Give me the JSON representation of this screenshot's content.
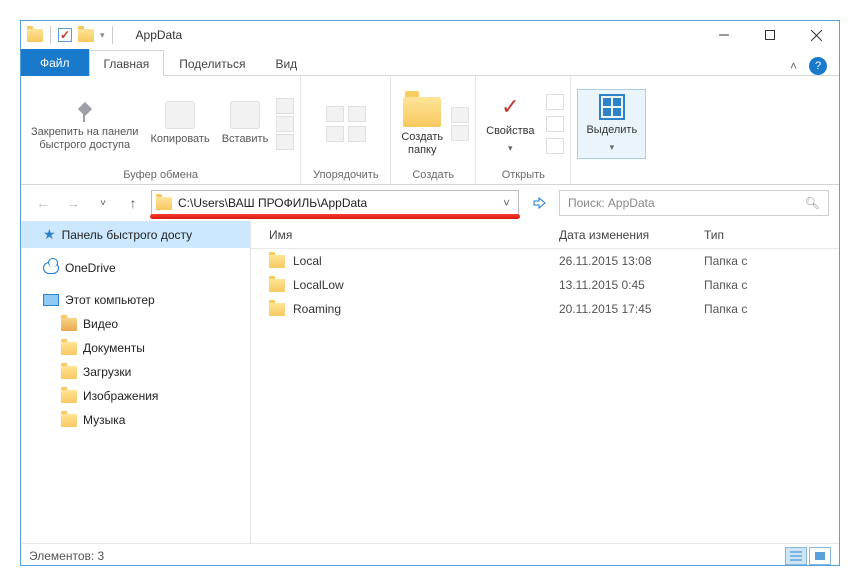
{
  "window_title": "AppData",
  "tabs": {
    "file": "Файл",
    "home": "Главная",
    "share": "Поделиться",
    "view": "Вид"
  },
  "ribbon": {
    "pin": "Закрепить на панели\nбыстрого доступа",
    "copy": "Копировать",
    "paste": "Вставить",
    "g_clipboard": "Буфер обмена",
    "g_organize": "Упорядочить",
    "new_folder": "Создать\nпапку",
    "g_new": "Создать",
    "properties": "Свойства",
    "g_open": "Открыть",
    "select": "Выделить"
  },
  "address_path": "C:\\Users\\ВАШ ПРОФИЛЬ\\AppData",
  "search_placeholder": "Поиск: AppData",
  "sidebar": {
    "quick": "Панель быстрого досту",
    "onedrive": "OneDrive",
    "pc": "Этот компьютер",
    "videos": "Видео",
    "documents": "Документы",
    "downloads": "Загрузки",
    "pictures": "Изображения",
    "music": "Музыка"
  },
  "columns": {
    "name": "Имя",
    "modified": "Дата изменения",
    "type": "Тип"
  },
  "items": [
    {
      "name": "Local",
      "modified": "26.11.2015 13:08",
      "type": "Папка с"
    },
    {
      "name": "LocalLow",
      "modified": "13.11.2015 0:45",
      "type": "Папка с"
    },
    {
      "name": "Roaming",
      "modified": "20.11.2015 17:45",
      "type": "Папка с"
    }
  ],
  "status_text": "Элементов: 3"
}
